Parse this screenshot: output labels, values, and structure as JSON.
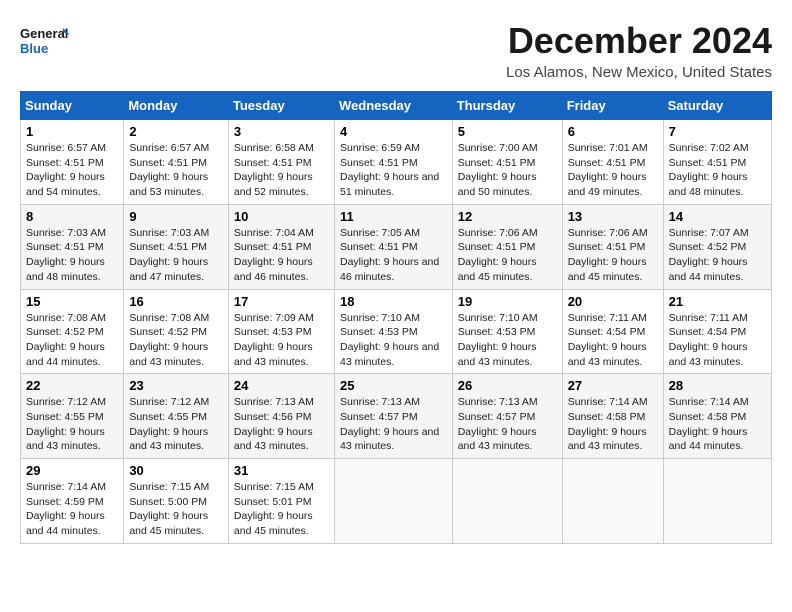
{
  "logo": {
    "line1": "General",
    "line2": "Blue"
  },
  "title": "December 2024",
  "location": "Los Alamos, New Mexico, United States",
  "days_of_week": [
    "Sunday",
    "Monday",
    "Tuesday",
    "Wednesday",
    "Thursday",
    "Friday",
    "Saturday"
  ],
  "weeks": [
    [
      {
        "day": "1",
        "sunrise": "6:57 AM",
        "sunset": "4:51 PM",
        "daylight": "9 hours and 54 minutes."
      },
      {
        "day": "2",
        "sunrise": "6:57 AM",
        "sunset": "4:51 PM",
        "daylight": "9 hours and 53 minutes."
      },
      {
        "day": "3",
        "sunrise": "6:58 AM",
        "sunset": "4:51 PM",
        "daylight": "9 hours and 52 minutes."
      },
      {
        "day": "4",
        "sunrise": "6:59 AM",
        "sunset": "4:51 PM",
        "daylight": "9 hours and 51 minutes."
      },
      {
        "day": "5",
        "sunrise": "7:00 AM",
        "sunset": "4:51 PM",
        "daylight": "9 hours and 50 minutes."
      },
      {
        "day": "6",
        "sunrise": "7:01 AM",
        "sunset": "4:51 PM",
        "daylight": "9 hours and 49 minutes."
      },
      {
        "day": "7",
        "sunrise": "7:02 AM",
        "sunset": "4:51 PM",
        "daylight": "9 hours and 48 minutes."
      }
    ],
    [
      {
        "day": "8",
        "sunrise": "7:03 AM",
        "sunset": "4:51 PM",
        "daylight": "9 hours and 48 minutes."
      },
      {
        "day": "9",
        "sunrise": "7:03 AM",
        "sunset": "4:51 PM",
        "daylight": "9 hours and 47 minutes."
      },
      {
        "day": "10",
        "sunrise": "7:04 AM",
        "sunset": "4:51 PM",
        "daylight": "9 hours and 46 minutes."
      },
      {
        "day": "11",
        "sunrise": "7:05 AM",
        "sunset": "4:51 PM",
        "daylight": "9 hours and 46 minutes."
      },
      {
        "day": "12",
        "sunrise": "7:06 AM",
        "sunset": "4:51 PM",
        "daylight": "9 hours and 45 minutes."
      },
      {
        "day": "13",
        "sunrise": "7:06 AM",
        "sunset": "4:51 PM",
        "daylight": "9 hours and 45 minutes."
      },
      {
        "day": "14",
        "sunrise": "7:07 AM",
        "sunset": "4:52 PM",
        "daylight": "9 hours and 44 minutes."
      }
    ],
    [
      {
        "day": "15",
        "sunrise": "7:08 AM",
        "sunset": "4:52 PM",
        "daylight": "9 hours and 44 minutes."
      },
      {
        "day": "16",
        "sunrise": "7:08 AM",
        "sunset": "4:52 PM",
        "daylight": "9 hours and 43 minutes."
      },
      {
        "day": "17",
        "sunrise": "7:09 AM",
        "sunset": "4:53 PM",
        "daylight": "9 hours and 43 minutes."
      },
      {
        "day": "18",
        "sunrise": "7:10 AM",
        "sunset": "4:53 PM",
        "daylight": "9 hours and 43 minutes."
      },
      {
        "day": "19",
        "sunrise": "7:10 AM",
        "sunset": "4:53 PM",
        "daylight": "9 hours and 43 minutes."
      },
      {
        "day": "20",
        "sunrise": "7:11 AM",
        "sunset": "4:54 PM",
        "daylight": "9 hours and 43 minutes."
      },
      {
        "day": "21",
        "sunrise": "7:11 AM",
        "sunset": "4:54 PM",
        "daylight": "9 hours and 43 minutes."
      }
    ],
    [
      {
        "day": "22",
        "sunrise": "7:12 AM",
        "sunset": "4:55 PM",
        "daylight": "9 hours and 43 minutes."
      },
      {
        "day": "23",
        "sunrise": "7:12 AM",
        "sunset": "4:55 PM",
        "daylight": "9 hours and 43 minutes."
      },
      {
        "day": "24",
        "sunrise": "7:13 AM",
        "sunset": "4:56 PM",
        "daylight": "9 hours and 43 minutes."
      },
      {
        "day": "25",
        "sunrise": "7:13 AM",
        "sunset": "4:57 PM",
        "daylight": "9 hours and 43 minutes."
      },
      {
        "day": "26",
        "sunrise": "7:13 AM",
        "sunset": "4:57 PM",
        "daylight": "9 hours and 43 minutes."
      },
      {
        "day": "27",
        "sunrise": "7:14 AM",
        "sunset": "4:58 PM",
        "daylight": "9 hours and 43 minutes."
      },
      {
        "day": "28",
        "sunrise": "7:14 AM",
        "sunset": "4:58 PM",
        "daylight": "9 hours and 44 minutes."
      }
    ],
    [
      {
        "day": "29",
        "sunrise": "7:14 AM",
        "sunset": "4:59 PM",
        "daylight": "9 hours and 44 minutes."
      },
      {
        "day": "30",
        "sunrise": "7:15 AM",
        "sunset": "5:00 PM",
        "daylight": "9 hours and 45 minutes."
      },
      {
        "day": "31",
        "sunrise": "7:15 AM",
        "sunset": "5:01 PM",
        "daylight": "9 hours and 45 minutes."
      },
      null,
      null,
      null,
      null
    ]
  ]
}
